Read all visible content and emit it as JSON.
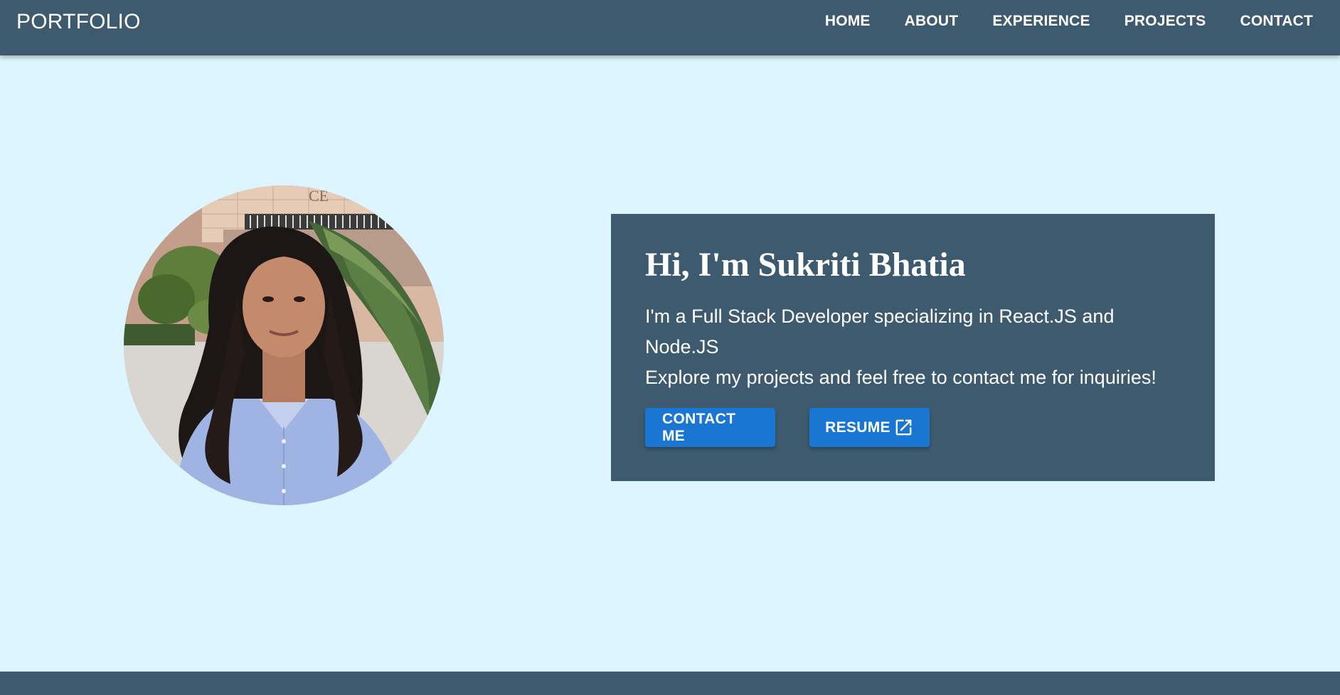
{
  "navbar": {
    "brand": "PORTFOLIO",
    "links": [
      {
        "label": "HOME"
      },
      {
        "label": "ABOUT"
      },
      {
        "label": "EXPERIENCE"
      },
      {
        "label": "PROJECTS"
      },
      {
        "label": "CONTACT"
      }
    ]
  },
  "hero": {
    "title": "Hi, I'm Sukriti Bhatia",
    "line1": "I'm a Full Stack Developer specializing in React.JS and Node.JS",
    "line2": "Explore my projects and feel free to contact me for inquiries!",
    "contact_button": "CONTACT ME",
    "resume_button": "RESUME",
    "resume_icon": "open-in-new-icon",
    "photo_background_sign": "CE"
  },
  "colors": {
    "page_background": "#ddf5ff",
    "bar_color": "#3d5a6e",
    "button_color": "#1976d2",
    "text_color": "#ffffff"
  }
}
